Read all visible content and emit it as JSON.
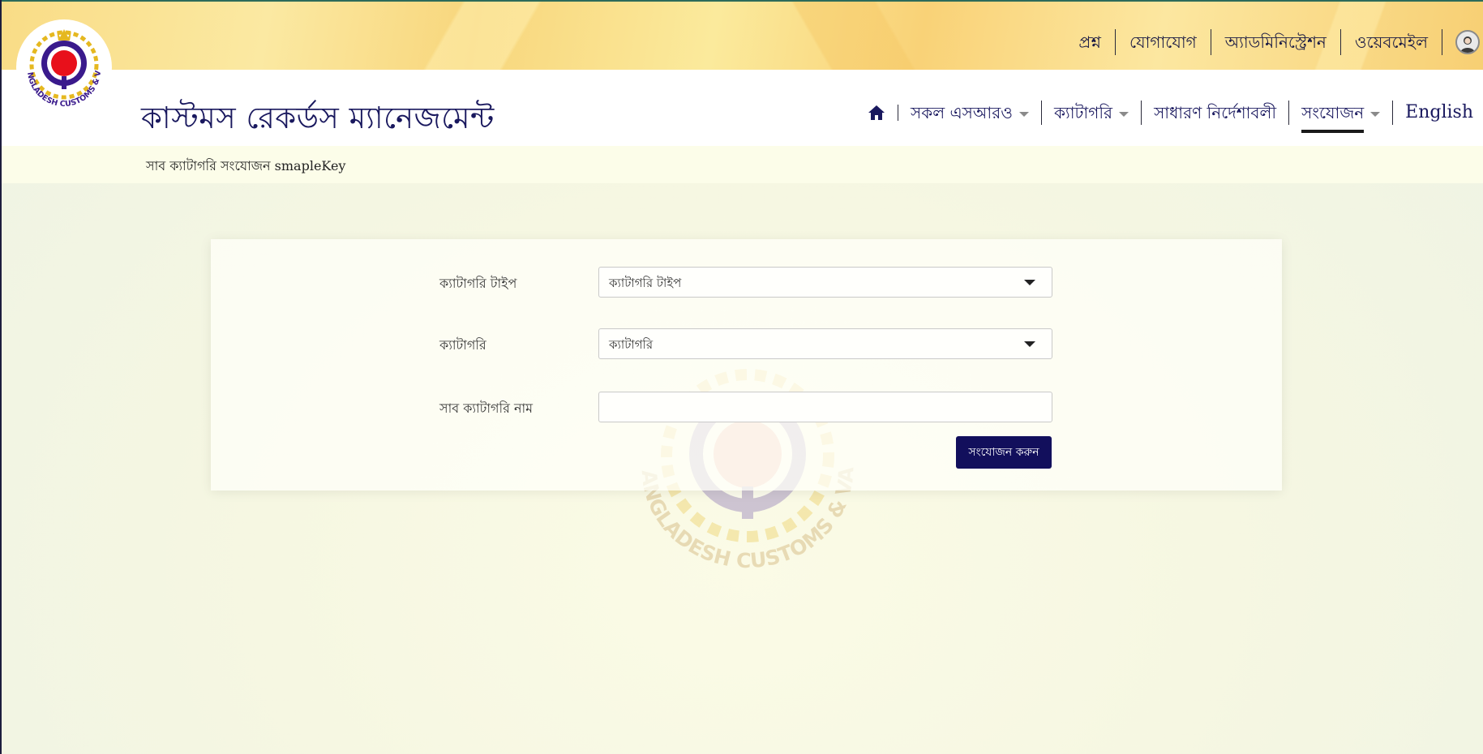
{
  "utility_nav": [
    "প্রশ্ন",
    "যোগাযোগ",
    "অ্যাডমিনিস্ট্রেশন",
    "ওয়েবমেইল"
  ],
  "header": {
    "title": "কাস্টমস রেকর্ডস ম্যানেজমেন্ট",
    "logo_text": "BANGLADESH CUSTOMS & VAT"
  },
  "main_nav": {
    "all_sros": "সকল এসআরও",
    "category": "ক্যাটাগরি",
    "general_instructions": "সাধারণ নির্দেশাবলী",
    "add": "সংযোজন",
    "language": "English"
  },
  "breadcrumb": "সাব ক্যাটাগরি সংযোজন smapleKey",
  "form": {
    "category_type_label": "ক্যাটাগরি টাইপ",
    "category_type_value": "ক্যাটাগরি টাইপ",
    "category_label": "ক্যাটাগরি",
    "category_value": "ক্যাটাগরি",
    "sub_category_name_label": "সাব ক্যাটাগরি নাম",
    "sub_category_name_value": "",
    "submit_label": "সংযোজন করুন"
  },
  "colors": {
    "brand_navy": "#120f5c",
    "banner_gold": "#f9dc86",
    "logo_red": "#e8101b",
    "logo_purple": "#3a1a8c"
  }
}
